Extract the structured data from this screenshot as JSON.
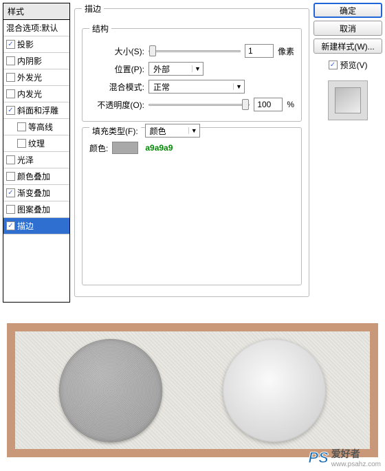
{
  "left": {
    "header": "样式",
    "blend": "混合选项:默认",
    "items": [
      {
        "label": "投影",
        "checked": true
      },
      {
        "label": "内阴影",
        "checked": false
      },
      {
        "label": "外发光",
        "checked": false
      },
      {
        "label": "内发光",
        "checked": false
      },
      {
        "label": "斜面和浮雕",
        "checked": true
      },
      {
        "label": "等高线",
        "checked": false,
        "indent": true
      },
      {
        "label": "纹理",
        "checked": false,
        "indent": true
      },
      {
        "label": "光泽",
        "checked": false
      },
      {
        "label": "颜色叠加",
        "checked": false
      },
      {
        "label": "渐变叠加",
        "checked": true
      },
      {
        "label": "图案叠加",
        "checked": false
      },
      {
        "label": "描边",
        "checked": true,
        "selected": true
      }
    ]
  },
  "stroke": {
    "title": "描边",
    "structure": "结构",
    "size_label": "大小(S):",
    "size_value": "1",
    "size_unit": "像素",
    "position_label": "位置(P):",
    "position_value": "外部",
    "blend_label": "混合模式:",
    "blend_value": "正常",
    "opacity_label": "不透明度(O):",
    "opacity_value": "100",
    "opacity_unit": "%",
    "fill_label": "填充类型(F):",
    "fill_value": "颜色",
    "color_label": "颜色:",
    "color_hex": "a9a9a9"
  },
  "right": {
    "ok": "确定",
    "cancel": "取消",
    "newstyle": "新建样式(W)...",
    "preview": "预览(V)"
  },
  "watermark": {
    "ps": "PS",
    "txt": "爱好者",
    "url": "www.psahz.com"
  }
}
